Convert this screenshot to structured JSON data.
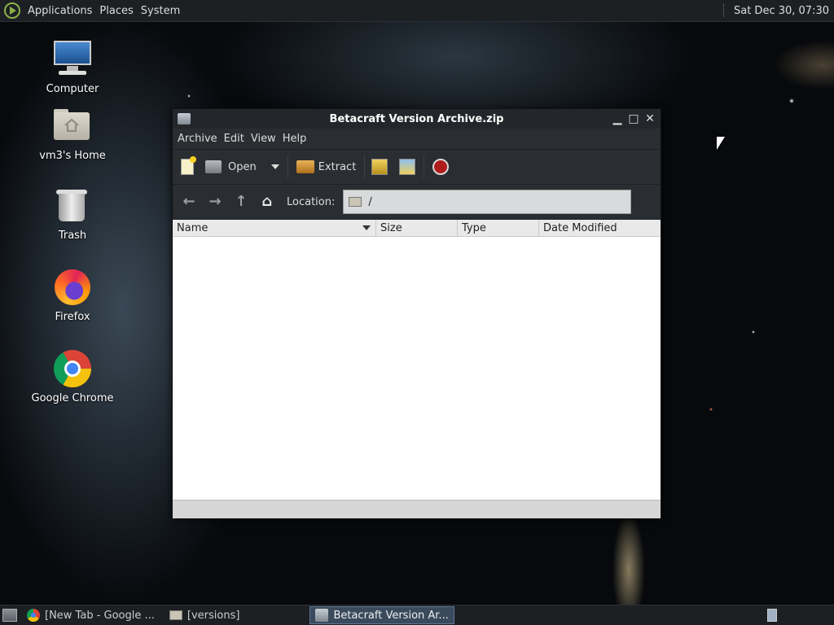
{
  "top_panel": {
    "menus": [
      "Applications",
      "Places",
      "System"
    ],
    "clock": "Sat Dec 30, 07:30"
  },
  "desktop": {
    "icons": [
      {
        "label": "Computer",
        "icon": "computer-icon"
      },
      {
        "label": "vm3's Home",
        "icon": "home-folder-icon"
      },
      {
        "label": "Trash",
        "icon": "trash-icon"
      },
      {
        "label": "Firefox",
        "icon": "firefox-icon"
      },
      {
        "label": "Google Chrome",
        "icon": "chrome-icon"
      }
    ]
  },
  "window": {
    "title": "Betacraft Version Archive.zip",
    "menu": [
      "Archive",
      "Edit",
      "View",
      "Help"
    ],
    "toolbar": {
      "open_label": "Open",
      "extract_label": "Extract"
    },
    "location": {
      "label": "Location:",
      "value": "/"
    },
    "columns": [
      "Name",
      "Size",
      "Type",
      "Date Modified"
    ]
  },
  "taskbar": {
    "tasks": [
      {
        "label": "[New Tab - Google ...",
        "icon": "chrome-icon"
      },
      {
        "label": "[versions]",
        "icon": "folder-icon"
      },
      {
        "label": "Betacraft Version Ar...",
        "icon": "archive-icon",
        "active": true
      }
    ]
  }
}
